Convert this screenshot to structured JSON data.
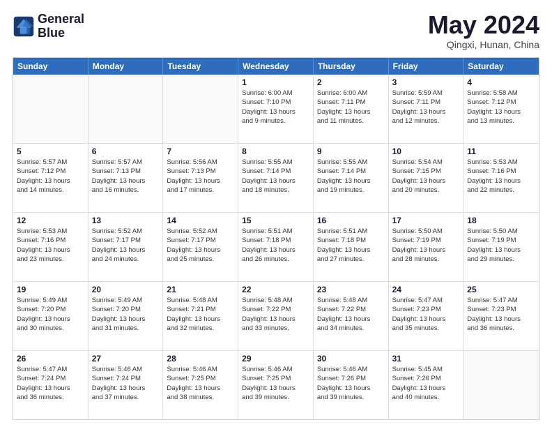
{
  "logo": {
    "line1": "General",
    "line2": "Blue"
  },
  "title": "May 2024",
  "subtitle": "Qingxi, Hunan, China",
  "header_days": [
    "Sunday",
    "Monday",
    "Tuesday",
    "Wednesday",
    "Thursday",
    "Friday",
    "Saturday"
  ],
  "rows": [
    [
      {
        "day": "",
        "info": "",
        "empty": true
      },
      {
        "day": "",
        "info": "",
        "empty": true
      },
      {
        "day": "",
        "info": "",
        "empty": true
      },
      {
        "day": "1",
        "info": "Sunrise: 6:00 AM\nSunset: 7:10 PM\nDaylight: 13 hours\nand 9 minutes."
      },
      {
        "day": "2",
        "info": "Sunrise: 6:00 AM\nSunset: 7:11 PM\nDaylight: 13 hours\nand 11 minutes."
      },
      {
        "day": "3",
        "info": "Sunrise: 5:59 AM\nSunset: 7:11 PM\nDaylight: 13 hours\nand 12 minutes."
      },
      {
        "day": "4",
        "info": "Sunrise: 5:58 AM\nSunset: 7:12 PM\nDaylight: 13 hours\nand 13 minutes."
      }
    ],
    [
      {
        "day": "5",
        "info": "Sunrise: 5:57 AM\nSunset: 7:12 PM\nDaylight: 13 hours\nand 14 minutes."
      },
      {
        "day": "6",
        "info": "Sunrise: 5:57 AM\nSunset: 7:13 PM\nDaylight: 13 hours\nand 16 minutes."
      },
      {
        "day": "7",
        "info": "Sunrise: 5:56 AM\nSunset: 7:13 PM\nDaylight: 13 hours\nand 17 minutes."
      },
      {
        "day": "8",
        "info": "Sunrise: 5:55 AM\nSunset: 7:14 PM\nDaylight: 13 hours\nand 18 minutes."
      },
      {
        "day": "9",
        "info": "Sunrise: 5:55 AM\nSunset: 7:14 PM\nDaylight: 13 hours\nand 19 minutes."
      },
      {
        "day": "10",
        "info": "Sunrise: 5:54 AM\nSunset: 7:15 PM\nDaylight: 13 hours\nand 20 minutes."
      },
      {
        "day": "11",
        "info": "Sunrise: 5:53 AM\nSunset: 7:16 PM\nDaylight: 13 hours\nand 22 minutes."
      }
    ],
    [
      {
        "day": "12",
        "info": "Sunrise: 5:53 AM\nSunset: 7:16 PM\nDaylight: 13 hours\nand 23 minutes."
      },
      {
        "day": "13",
        "info": "Sunrise: 5:52 AM\nSunset: 7:17 PM\nDaylight: 13 hours\nand 24 minutes."
      },
      {
        "day": "14",
        "info": "Sunrise: 5:52 AM\nSunset: 7:17 PM\nDaylight: 13 hours\nand 25 minutes."
      },
      {
        "day": "15",
        "info": "Sunrise: 5:51 AM\nSunset: 7:18 PM\nDaylight: 13 hours\nand 26 minutes."
      },
      {
        "day": "16",
        "info": "Sunrise: 5:51 AM\nSunset: 7:18 PM\nDaylight: 13 hours\nand 27 minutes."
      },
      {
        "day": "17",
        "info": "Sunrise: 5:50 AM\nSunset: 7:19 PM\nDaylight: 13 hours\nand 28 minutes."
      },
      {
        "day": "18",
        "info": "Sunrise: 5:50 AM\nSunset: 7:19 PM\nDaylight: 13 hours\nand 29 minutes."
      }
    ],
    [
      {
        "day": "19",
        "info": "Sunrise: 5:49 AM\nSunset: 7:20 PM\nDaylight: 13 hours\nand 30 minutes."
      },
      {
        "day": "20",
        "info": "Sunrise: 5:49 AM\nSunset: 7:20 PM\nDaylight: 13 hours\nand 31 minutes."
      },
      {
        "day": "21",
        "info": "Sunrise: 5:48 AM\nSunset: 7:21 PM\nDaylight: 13 hours\nand 32 minutes."
      },
      {
        "day": "22",
        "info": "Sunrise: 5:48 AM\nSunset: 7:22 PM\nDaylight: 13 hours\nand 33 minutes."
      },
      {
        "day": "23",
        "info": "Sunrise: 5:48 AM\nSunset: 7:22 PM\nDaylight: 13 hours\nand 34 minutes."
      },
      {
        "day": "24",
        "info": "Sunrise: 5:47 AM\nSunset: 7:23 PM\nDaylight: 13 hours\nand 35 minutes."
      },
      {
        "day": "25",
        "info": "Sunrise: 5:47 AM\nSunset: 7:23 PM\nDaylight: 13 hours\nand 36 minutes."
      }
    ],
    [
      {
        "day": "26",
        "info": "Sunrise: 5:47 AM\nSunset: 7:24 PM\nDaylight: 13 hours\nand 36 minutes."
      },
      {
        "day": "27",
        "info": "Sunrise: 5:46 AM\nSunset: 7:24 PM\nDaylight: 13 hours\nand 37 minutes."
      },
      {
        "day": "28",
        "info": "Sunrise: 5:46 AM\nSunset: 7:25 PM\nDaylight: 13 hours\nand 38 minutes."
      },
      {
        "day": "29",
        "info": "Sunrise: 5:46 AM\nSunset: 7:25 PM\nDaylight: 13 hours\nand 39 minutes."
      },
      {
        "day": "30",
        "info": "Sunrise: 5:46 AM\nSunset: 7:26 PM\nDaylight: 13 hours\nand 39 minutes."
      },
      {
        "day": "31",
        "info": "Sunrise: 5:45 AM\nSunset: 7:26 PM\nDaylight: 13 hours\nand 40 minutes."
      },
      {
        "day": "",
        "info": "",
        "empty": true
      }
    ]
  ]
}
